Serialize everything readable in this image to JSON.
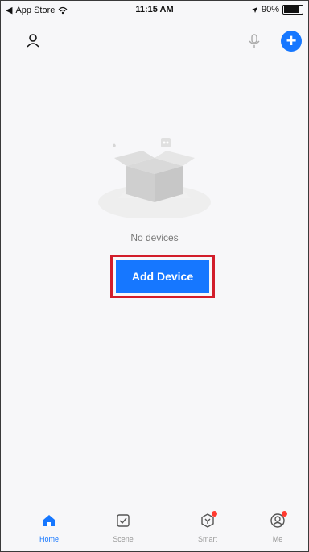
{
  "status_bar": {
    "back_app": "App Store",
    "time": "11:15 AM",
    "battery": "90%",
    "battery_level": 0.9
  },
  "main": {
    "empty_text": "No devices",
    "add_button_label": "Add Device"
  },
  "tabs": [
    {
      "label": "Home",
      "active": true
    },
    {
      "label": "Scene",
      "active": false
    },
    {
      "label": "Smart",
      "active": false
    },
    {
      "label": "Me",
      "active": false
    }
  ],
  "colors": {
    "accent": "#1677ff",
    "highlight": "#d21d2a"
  },
  "icons": {
    "user": "user-icon",
    "mic": "microphone-icon",
    "plus": "plus-icon",
    "home": "home-icon",
    "scene": "scene-icon",
    "smart": "smart-icon",
    "me": "profile-icon"
  }
}
